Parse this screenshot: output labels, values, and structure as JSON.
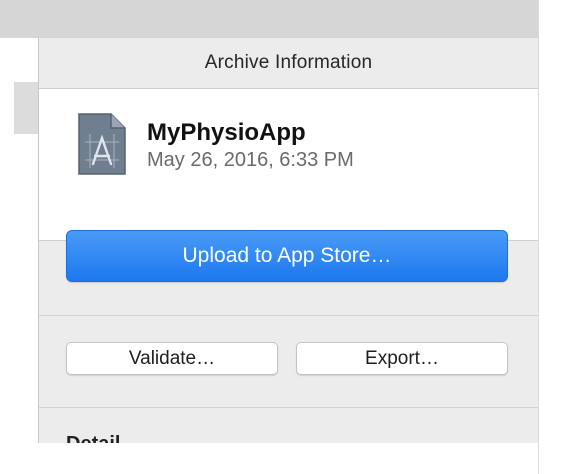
{
  "panel": {
    "header_title": "Archive Information",
    "archive": {
      "name": "MyPhysioApp",
      "date": "May 26, 2016, 6:33 PM",
      "icon": "xcode-archive-document-icon"
    },
    "actions": {
      "upload_label": "Upload to App Store…",
      "validate_label": "Validate…",
      "export_label": "Export…"
    },
    "details_heading": "Detail"
  },
  "colors": {
    "primary_button": "#1d78ef",
    "panel_background": "#ececec"
  }
}
